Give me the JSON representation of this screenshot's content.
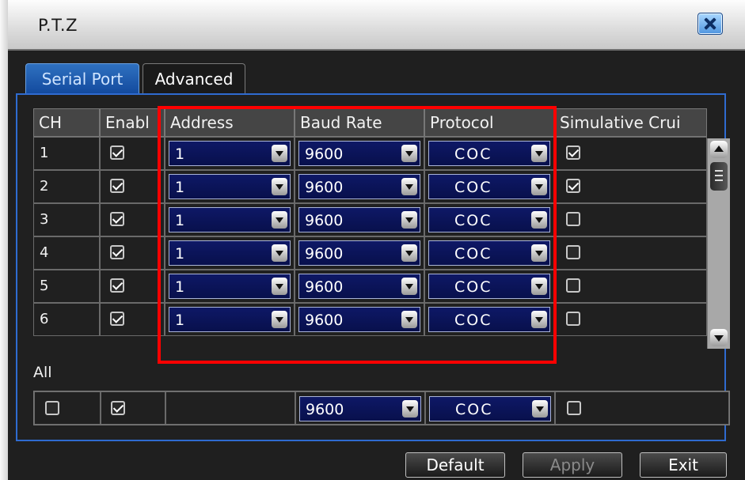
{
  "window": {
    "title": "P.T.Z"
  },
  "tabs": [
    {
      "label": "Serial Port",
      "active": true
    },
    {
      "label": "Advanced",
      "active": false
    }
  ],
  "table": {
    "columns": [
      "CH",
      "Enabl",
      "Address",
      "Baud Rate",
      "Protocol",
      "Simulative Crui"
    ],
    "rows": [
      {
        "ch": "1",
        "enabled": true,
        "address": "1",
        "baud_rate": "9600",
        "protocol": "COC",
        "simulative_cruise": true
      },
      {
        "ch": "2",
        "enabled": true,
        "address": "1",
        "baud_rate": "9600",
        "protocol": "COC",
        "simulative_cruise": true
      },
      {
        "ch": "3",
        "enabled": true,
        "address": "1",
        "baud_rate": "9600",
        "protocol": "COC",
        "simulative_cruise": false
      },
      {
        "ch": "4",
        "enabled": true,
        "address": "1",
        "baud_rate": "9600",
        "protocol": "COC",
        "simulative_cruise": false
      },
      {
        "ch": "5",
        "enabled": true,
        "address": "1",
        "baud_rate": "9600",
        "protocol": "COC",
        "simulative_cruise": false
      },
      {
        "ch": "6",
        "enabled": true,
        "address": "1",
        "baud_rate": "9600",
        "protocol": "COC",
        "simulative_cruise": false
      }
    ]
  },
  "all_row": {
    "label": "All",
    "select_all": false,
    "enabled": true,
    "baud_rate": "9600",
    "protocol": "COC",
    "simulative_cruise": false
  },
  "buttons": {
    "default": "Default",
    "apply": "Apply",
    "exit": "Exit"
  },
  "colors": {
    "active_tab": "#134a9e",
    "panel_border": "#2f6bd0",
    "dropdown_bg": "#0e1866",
    "highlight": "#ff0000",
    "close_button": "#4f95df"
  }
}
